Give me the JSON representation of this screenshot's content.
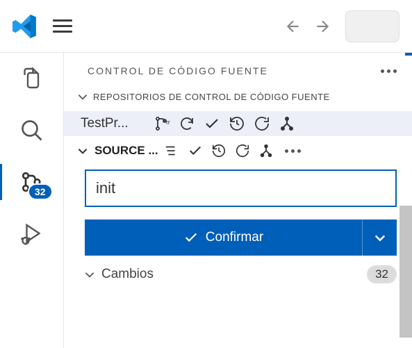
{
  "titlebar": {},
  "activitybar": {
    "scm_badge": "32"
  },
  "panel": {
    "title": "CONTROL DE CÓDIGO FUENTE",
    "repos_section": "REPOSITORIOS DE CONTROL DE CÓDIGO FUENTE",
    "repo_name": "TestPr...",
    "branch_label": "m",
    "source_section": "SOURCE ...",
    "commit_input": "init",
    "commit_button": "Confirmar",
    "changes_label": "Cambios",
    "changes_count": "32"
  }
}
